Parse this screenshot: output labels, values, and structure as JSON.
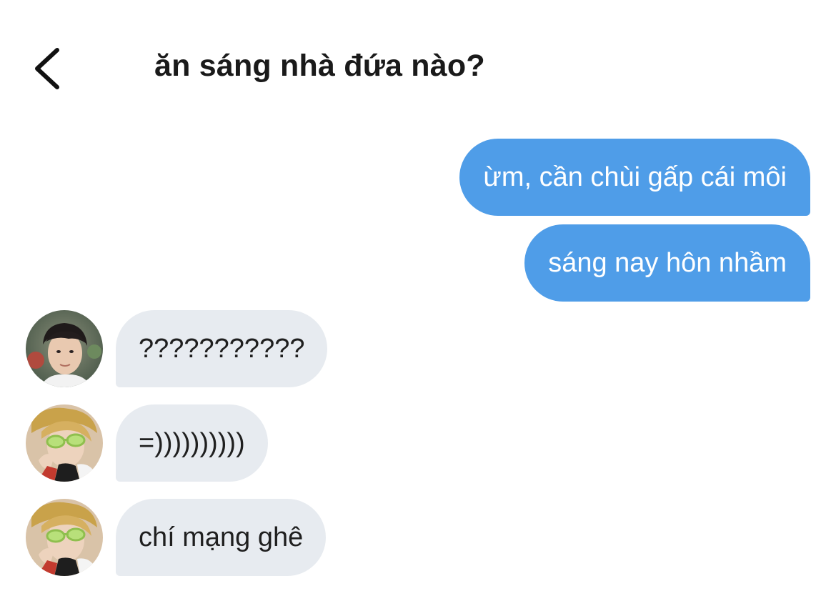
{
  "header": {
    "title": "ăn sáng nhà đứa nào?",
    "back_icon": "chevron-left-icon"
  },
  "messages": [
    {
      "side": "out",
      "text": "ừm, cần chùi gấp cái môi"
    },
    {
      "side": "out",
      "text": "sáng nay hôn nhầm"
    },
    {
      "side": "in",
      "text": "???????????",
      "avatar": "avatar-1"
    },
    {
      "side": "in",
      "text": "=))))))))))",
      "avatar": "avatar-2"
    },
    {
      "side": "in",
      "text": "chí mạng ghê",
      "avatar": "avatar-2"
    }
  ],
  "colors": {
    "outgoing_bubble": "#4f9de8",
    "incoming_bubble": "#e7ebf0",
    "title_text": "#1a1a1a"
  }
}
